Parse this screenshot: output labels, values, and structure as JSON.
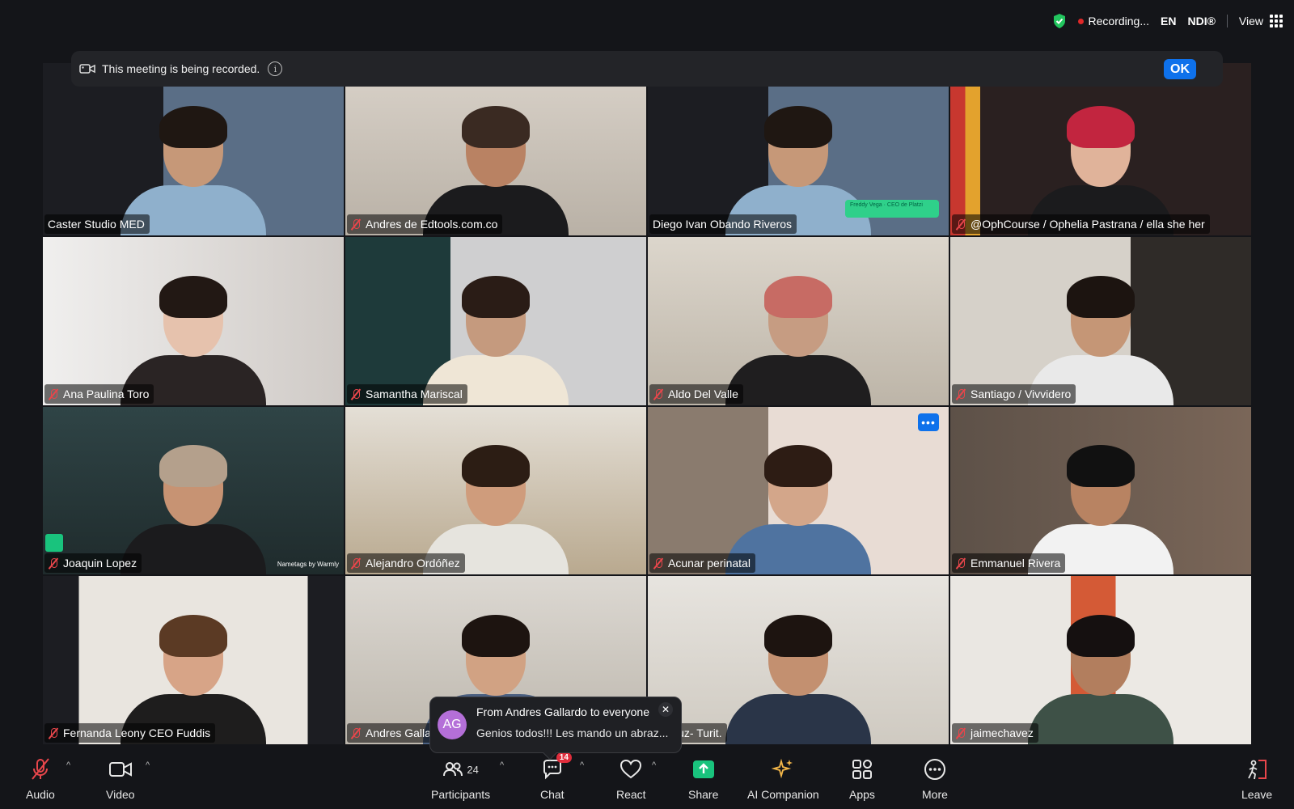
{
  "top_bar": {
    "recording_label": "Recording...",
    "language": "EN",
    "ndi": "NDI®",
    "view_label": "View"
  },
  "banner": {
    "message": "This meeting is being recorded.",
    "info_glyph": "i",
    "ok_label": "OK"
  },
  "tiles": [
    {
      "name": "Caster Studio MED",
      "muted": false,
      "active": true
    },
    {
      "name": "Andres de Edtools.com.co",
      "muted": true
    },
    {
      "name": "Diego Ivan Obando Riveros",
      "muted": false,
      "lower_third": "Freddy Vega · CEO de Platzi"
    },
    {
      "name": "@OphCourse / Ophelia Pastrana / ella she her",
      "muted": true
    },
    {
      "name": "Ana Paulina Toro",
      "muted": true
    },
    {
      "name": "Samantha Mariscal",
      "muted": true
    },
    {
      "name": "Aldo Del Valle",
      "muted": true
    },
    {
      "name": "Santiago / Vivvidero",
      "muted": true
    },
    {
      "name": "Joaquin Lopez",
      "muted": true,
      "watermark": "Nametags by Warmly"
    },
    {
      "name": "Alejandro Ordóñez",
      "muted": true
    },
    {
      "name": "Acunar perinatal",
      "muted": true
    },
    {
      "name": "Emmanuel Rivera",
      "muted": true
    },
    {
      "name": "Fernanda Leony CEO Fuddis",
      "muted": true
    },
    {
      "name": "Andres Galla",
      "muted": true
    },
    {
      "name": "an cruz- Turit.",
      "muted": false
    },
    {
      "name": "jaimechavez",
      "muted": true
    }
  ],
  "chat_toast": {
    "initials": "AG",
    "from": "From Andres Gallardo to everyone",
    "message": "Genios todos!!! Les mando un abraz...",
    "close_glyph": "✕"
  },
  "toolbar": {
    "audio": "Audio",
    "video": "Video",
    "participants": "Participants",
    "participants_count": "24",
    "chat": "Chat",
    "chat_badge": "14",
    "react": "React",
    "share": "Share",
    "ai_companion": "AI Companion",
    "apps": "Apps",
    "more": "More",
    "leave": "Leave"
  },
  "icons": {
    "security": "shield-check-icon",
    "recording": "record-dot-icon",
    "view": "grid-icon",
    "audio": "mic-muted-icon",
    "video": "camera-icon",
    "participants": "people-icon",
    "chat": "chat-bubble-icon",
    "react": "heart-icon",
    "share": "share-arrow-icon",
    "ai_companion": "sparkle-icon",
    "apps": "apps-icon",
    "more": "more-dots-icon",
    "leave": "leave-door-icon"
  },
  "colors": {
    "background": "#141519",
    "active_speaker": "#22c55e",
    "accent": "#0e71eb",
    "muted_red": "#e8464b",
    "share_green": "#19c37d"
  }
}
